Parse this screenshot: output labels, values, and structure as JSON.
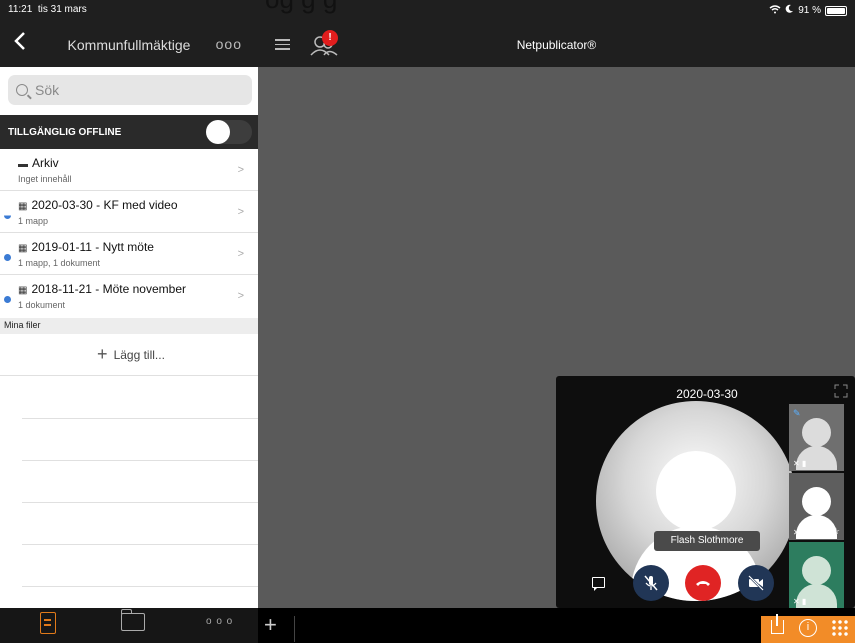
{
  "top_fragment": "og  g  g",
  "status_bar": {
    "time": "11:21",
    "date": "tis 31 mars",
    "battery": "91 %"
  },
  "left_header": {
    "back_label": "<",
    "title": "Kommunfullmäktige",
    "more_label": "ooo"
  },
  "search": {
    "placeholder": "Sök"
  },
  "offline": {
    "label": "TILLGÄNGLIG OFFLINE",
    "enabled": false
  },
  "folders": [
    {
      "title": "Arkiv",
      "subtitle": "Inget innehåll",
      "icon": "archive-icon",
      "unread": "none"
    },
    {
      "title": "2020-03-30 - KF med video",
      "subtitle": "1 mapp",
      "icon": "calendar-icon",
      "unread": "partial"
    },
    {
      "title": "2019-01-11 - Nytt möte",
      "subtitle": "1 mapp, 1 dokument",
      "icon": "calendar-icon",
      "unread": "full"
    },
    {
      "title": "2018-11-21 - Möte november",
      "subtitle": "1 dokument",
      "icon": "calendar-icon",
      "unread": "full"
    }
  ],
  "my_files": {
    "section_label": "Mina filer",
    "add_label": "Lägg till..."
  },
  "main_header": {
    "brand": "Netpublicator®",
    "badge": "!"
  },
  "video": {
    "title": "2020-03-30",
    "speaker": "Flash Slothmore",
    "thumbnails": [
      {
        "color": "#6f6f6f",
        "face": "#dcdcdc"
      },
      {
        "color": "#6f6f6f",
        "face": "#ffffff"
      },
      {
        "color": "#2d7d5f",
        "face": "#cfe3d6"
      }
    ]
  },
  "colors": {
    "accent": "#f28c28",
    "hangup": "#e02424",
    "control": "#213656",
    "dot": "#3b7bd4"
  }
}
